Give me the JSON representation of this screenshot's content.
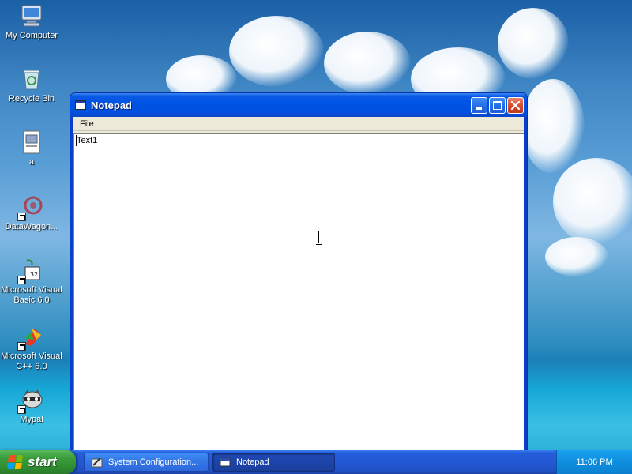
{
  "desktop": {
    "icons": [
      {
        "label": "My Computer"
      },
      {
        "label": "Recycle Bin"
      },
      {
        "label": "a"
      },
      {
        "label": "DataWagon..."
      },
      {
        "label": "Microsoft Visual Basic 6.0"
      },
      {
        "label": "Microsoft Visual C++ 6.0"
      },
      {
        "label": "Mypal"
      }
    ]
  },
  "window": {
    "title": "Notepad",
    "menu": [
      {
        "label": "File"
      }
    ],
    "editor_text": "Text1"
  },
  "taskbar": {
    "start_label": "start",
    "tasks": [
      {
        "label": "System Configuration...",
        "active": false
      },
      {
        "label": "Notepad",
        "active": true
      }
    ],
    "clock": "11:06 PM"
  },
  "colors": {
    "title_blue": "#0054e3",
    "close_red": "#d5482b",
    "start_green": "#3c9e3d",
    "tray_blue": "#0f8fdf"
  }
}
